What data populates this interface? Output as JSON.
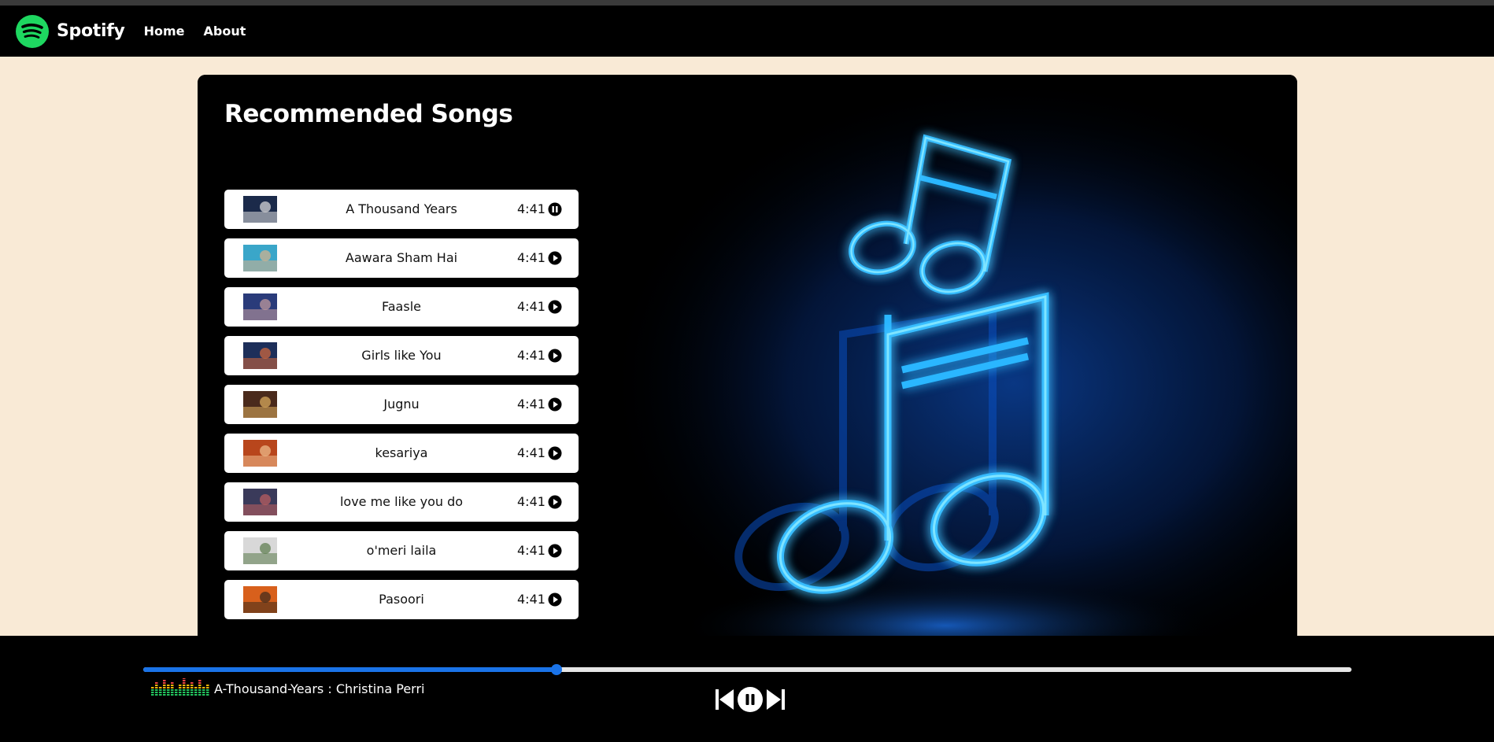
{
  "nav": {
    "brand": "Spotify",
    "links": [
      "Home",
      "About"
    ],
    "logo_color": "#1ed760"
  },
  "main": {
    "title": "Recommended Songs",
    "songs": [
      {
        "name": "A Thousand Years",
        "duration": "4:41",
        "state": "pause-icon",
        "thumb": [
          "#1b2a4a",
          "#e0e0e0"
        ]
      },
      {
        "name": "Aawara Sham Hai",
        "duration": "4:41",
        "state": "play-icon",
        "thumb": [
          "#3aa6c9",
          "#d9b38c"
        ]
      },
      {
        "name": "Faasle",
        "duration": "4:41",
        "state": "play-icon",
        "thumb": [
          "#2a3b7a",
          "#c9a0a0"
        ]
      },
      {
        "name": "Girls like You",
        "duration": "4:41",
        "state": "play-icon",
        "thumb": [
          "#1d2f5a",
          "#d96a3a"
        ]
      },
      {
        "name": "Jugnu",
        "duration": "4:41",
        "state": "play-icon",
        "thumb": [
          "#4a2a1c",
          "#e0b060"
        ]
      },
      {
        "name": "kesariya",
        "duration": "4:41",
        "state": "play-icon",
        "thumb": [
          "#b8461c",
          "#f0c090"
        ]
      },
      {
        "name": "love me like you do",
        "duration": "4:41",
        "state": "play-icon",
        "thumb": [
          "#3a3a5a",
          "#c06060"
        ]
      },
      {
        "name": "o'meri laila",
        "duration": "4:41",
        "state": "play-icon",
        "thumb": [
          "#d8d8d8",
          "#5a7a4a"
        ]
      },
      {
        "name": "Pasoori",
        "duration": "4:41",
        "state": "play-icon",
        "thumb": [
          "#d8601c",
          "#3a2a1c"
        ]
      }
    ]
  },
  "player": {
    "now_playing": "A-Thousand-Years : Christina Perri",
    "progress": 0.342,
    "accent": "#1a73e8",
    "controls": [
      "previous-icon",
      "pause-icon",
      "next-icon"
    ]
  }
}
